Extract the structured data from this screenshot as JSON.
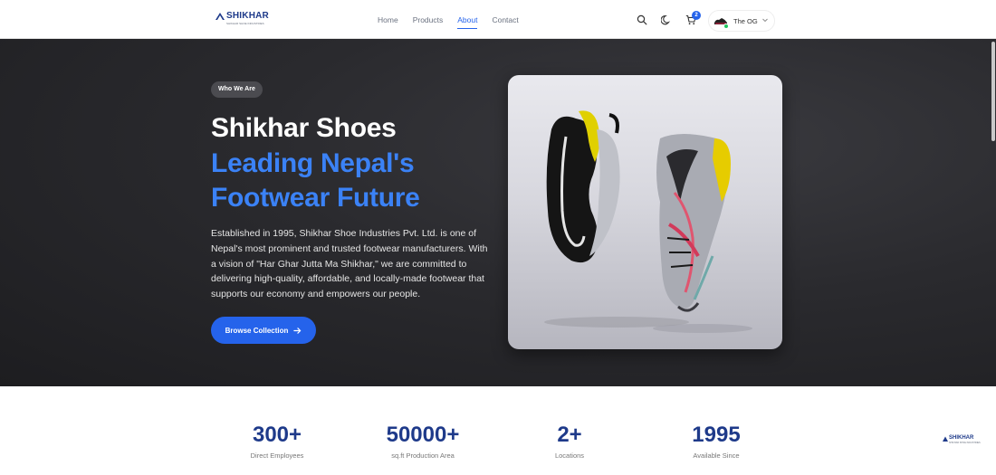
{
  "brand": {
    "name": "SHIKHAR",
    "tagline": "SHIKHAR SHOE INDUSTRIES"
  },
  "nav": {
    "links": [
      {
        "label": "Home",
        "active": false
      },
      {
        "label": "Products",
        "active": false
      },
      {
        "label": "About",
        "active": true
      },
      {
        "label": "Contact",
        "active": false
      }
    ]
  },
  "header": {
    "icons": [
      "search-icon",
      "moon-icon",
      "cart-icon"
    ],
    "cart_count": "2",
    "user": {
      "name": "The OG",
      "status_color": "#22c55e"
    }
  },
  "hero": {
    "badge": "Who We Are",
    "title": "Shikhar Shoes",
    "subtitle_line1": "Leading Nepal's",
    "subtitle_line2": "Footwear Future",
    "description": "Established in 1995, Shikhar Shoe Industries Pvt. Ltd. is one of Nepal's most prominent and trusted footwear manufacturers. With a vision of \"Har Ghar Jutta Ma Shikhar,\" we are committed to delivering high-quality, affordable, and locally-made footwear that supports our economy and empowers our people.",
    "cta_label": "Browse Collection",
    "image_alt": "running shoes"
  },
  "stats": [
    {
      "value": "300+",
      "label": "Direct Employees"
    },
    {
      "value": "50000+",
      "label": "sq.ft Production Area"
    },
    {
      "value": "2+",
      "label": "Locations"
    },
    {
      "value": "1995",
      "label": "Available Since"
    }
  ],
  "colors": {
    "accent": "#2563eb",
    "stat_text": "#1e3a8a",
    "hero_bg": "#2a2a2e"
  }
}
